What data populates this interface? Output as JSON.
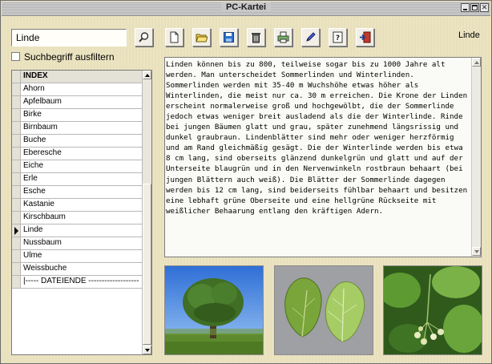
{
  "window": {
    "title": "PC-Kartei",
    "buttons": [
      "minimize-icon",
      "maximize-icon",
      "close-icon"
    ]
  },
  "search": {
    "value": "Linde",
    "button_icon": "magnifier-icon"
  },
  "toolbar": {
    "icons": [
      "new-document-icon",
      "open-folder-icon",
      "save-disk-icon",
      "recycle-bin-icon",
      "printer-icon",
      "pen-icon",
      "help-icon",
      "exit-door-icon"
    ]
  },
  "current_word": "Linde",
  "filter_checkbox": {
    "label": "Suchbegriff ausfiltern",
    "checked": false
  },
  "index_list": {
    "header": "INDEX",
    "items": [
      "Ahorn",
      "Apfelbaum",
      "Birke",
      "Birnbaum",
      "Buche",
      "Eberesche",
      "Eiche",
      "Erle",
      "Esche",
      "Kastanie",
      "Kirschbaum",
      "Linde",
      "Nussbaum",
      "Ulme",
      "Weissbuche",
      "|----- DATEIENDE -------------------"
    ],
    "selected": "Linde"
  },
  "article_text": "Linden können bis zu 800, teilweise sogar bis zu 1000 Jahre alt werden. Man unterscheidet Sommerlinden und Winterlinden. Sommerlinden werden mit 35-40 m Wuchshöhe etwas höher als Winterlinden, die meist nur ca. 30 m erreichen. Die Krone der Linden erscheint normalerweise groß und hochgewölbt, die der Sommerlinde jedoch etwas weniger breit ausladend als die der Winterlinde. Rinde bei jungen Bäumen glatt und grau, später zunehmend längsrissig und dunkel graubraun. Lindenblätter sind mehr oder weniger herzförmig und am Rand gleichmäßig gesägt. Die der Winterlinde werden bis etwa 8 cm lang, sind oberseits glänzend dunkelgrün und glatt und auf der Unterseite blaugrün und in den Nervenwinkeln rostbraun behaart (bei jungen Blättern auch weiß). Die Blätter der Sommerlinde dagegen werden bis 12 cm lang, sind beiderseits fühlbar behaart und besitzen eine lebhaft grüne Oberseite und eine hellgrüne Rückseite mit weißlicher Behaarung entlang den kräftigen Adern.",
  "photos": [
    "linden-tree-photo",
    "linden-leaves-photo",
    "linden-blossom-photo"
  ]
}
